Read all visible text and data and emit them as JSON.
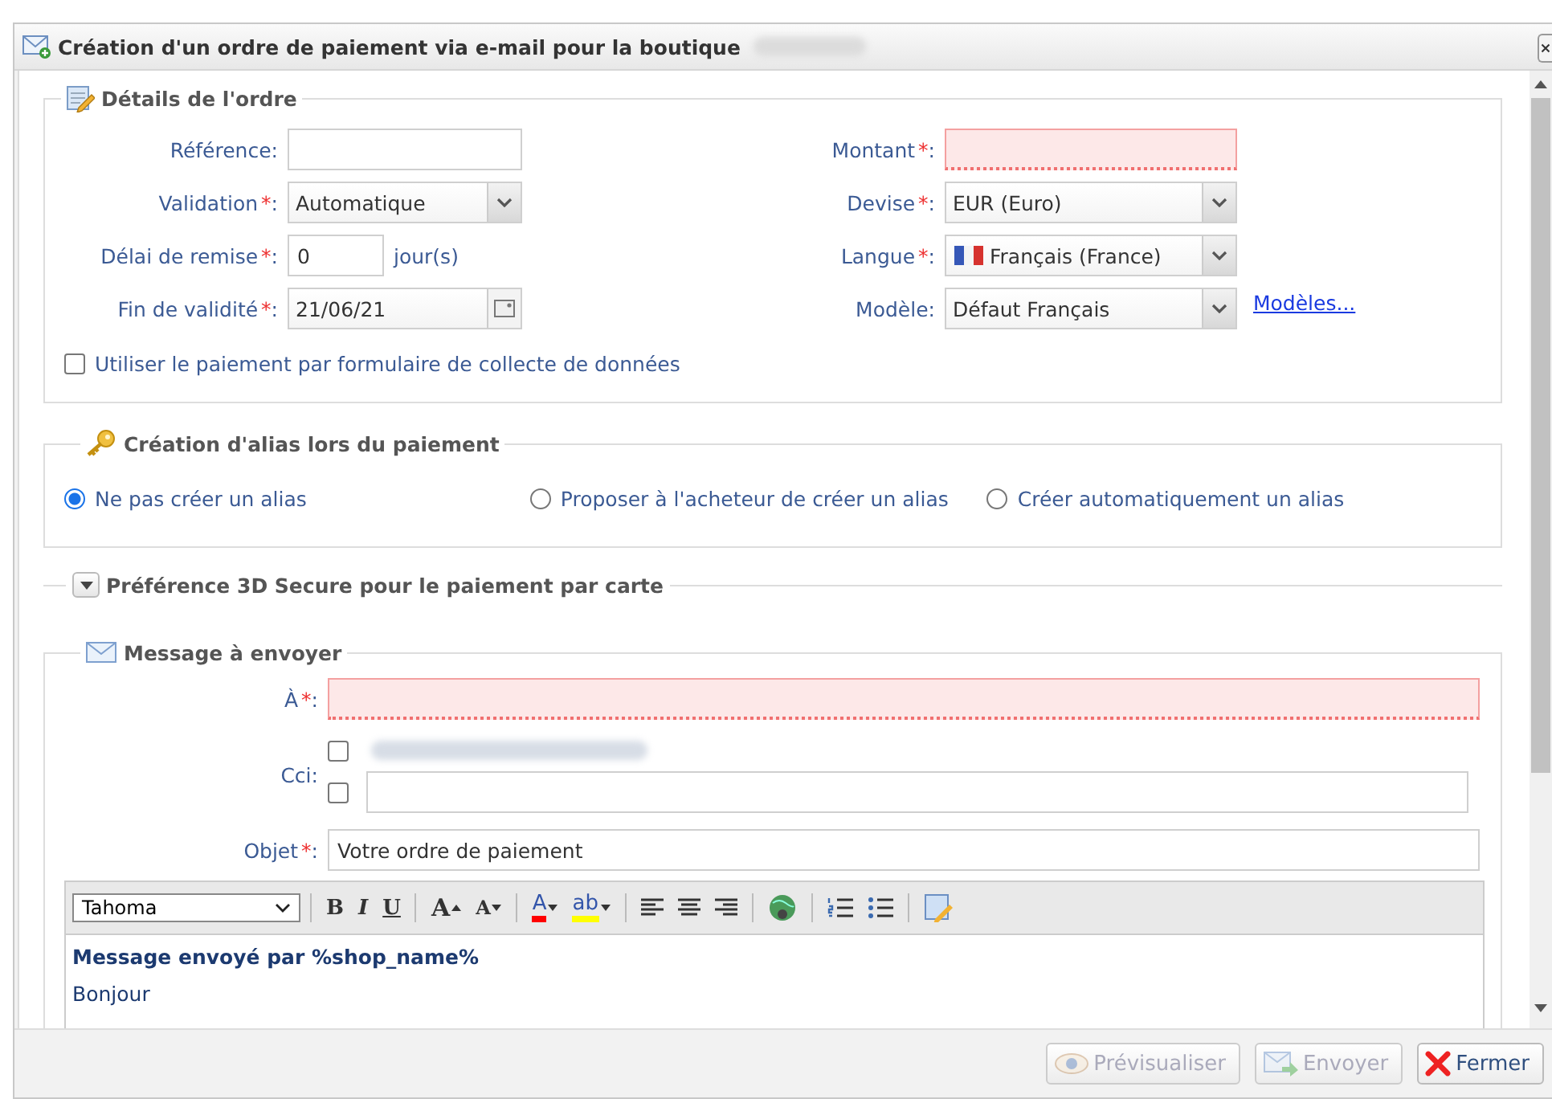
{
  "window": {
    "title": "Création d'un ordre de paiement via e-mail pour la boutique"
  },
  "required_mark": "*",
  "label_suffix": ":",
  "order_details": {
    "legend": "Détails de l'ordre",
    "left_fields": [
      {
        "label": "Référence",
        "required": false,
        "kind": "text",
        "invalid": false
      },
      {
        "label": "Validation",
        "required": true,
        "kind": "select",
        "value": "Automatique",
        "invalid": false
      },
      {
        "label": "Délai de remise",
        "required": true,
        "kind": "number-unit",
        "value": "0",
        "unit": "jour(s)",
        "invalid": false
      },
      {
        "label": "Fin de validité",
        "required": true,
        "kind": "date",
        "value": "21/06/21",
        "invalid": false
      }
    ],
    "right_fields": [
      {
        "label": "Montant",
        "required": true,
        "kind": "text",
        "invalid": true
      },
      {
        "label": "Devise",
        "required": true,
        "kind": "select",
        "value": "EUR (Euro)",
        "invalid": false
      },
      {
        "label": "Langue",
        "required": true,
        "kind": "flag-select",
        "value": "Français (France)",
        "invalid": false
      },
      {
        "label": "Modèle",
        "required": false,
        "kind": "select",
        "value": "Défaut Français",
        "invalid": false,
        "link": "Modèles..."
      }
    ],
    "checkbox": {
      "label": "Utiliser le paiement par formulaire de collecte de données",
      "checked": false
    }
  },
  "alias": {
    "legend": "Création d'alias lors du paiement",
    "options": [
      {
        "label": "Ne pas créer un alias",
        "selected": true
      },
      {
        "label": "Proposer à l'acheteur de créer un alias",
        "selected": false
      },
      {
        "label": "Créer automatiquement un alias",
        "selected": false
      }
    ]
  },
  "secure3d": {
    "legend": "Préférence 3D Secure pour le paiement par carte",
    "expanded": false
  },
  "message": {
    "legend": "Message à envoyer",
    "to": {
      "label": "À",
      "required": true,
      "invalid": true
    },
    "cci": {
      "label": "Cci",
      "rows": [
        {
          "checked": false,
          "kind": "blurred"
        },
        {
          "checked": false,
          "kind": "input"
        }
      ]
    },
    "subject": {
      "label": "Objet",
      "required": true,
      "value": "Votre ordre de paiement"
    },
    "editor": {
      "font": "Tahoma",
      "tools": [
        {
          "kind": "separator"
        },
        {
          "kind": "bold",
          "label": "B"
        },
        {
          "kind": "italic",
          "label": "I"
        },
        {
          "kind": "underline",
          "label": "U"
        },
        {
          "kind": "separator"
        },
        {
          "kind": "grow",
          "label": "A"
        },
        {
          "kind": "shrink",
          "label": "A"
        },
        {
          "kind": "separator"
        },
        {
          "kind": "color",
          "label": "A",
          "color": "#ff0000"
        },
        {
          "kind": "color",
          "label": "ab",
          "color": "#ffff00"
        },
        {
          "kind": "separator"
        },
        {
          "kind": "align-left"
        },
        {
          "kind": "align-center"
        },
        {
          "kind": "align-right"
        },
        {
          "kind": "separator"
        },
        {
          "kind": "globe"
        },
        {
          "kind": "separator"
        },
        {
          "kind": "numbered-list"
        },
        {
          "kind": "bullet-list"
        },
        {
          "kind": "separator"
        },
        {
          "kind": "source"
        }
      ],
      "heading": "Message envoyé par %shop_name%",
      "body": "Bonjour"
    }
  },
  "buttons": [
    {
      "label": "Prévisualiser",
      "kind": "preview",
      "disabled": true
    },
    {
      "label": "Envoyer",
      "kind": "send",
      "disabled": true
    },
    {
      "label": "Fermer",
      "kind": "close",
      "disabled": false
    }
  ]
}
